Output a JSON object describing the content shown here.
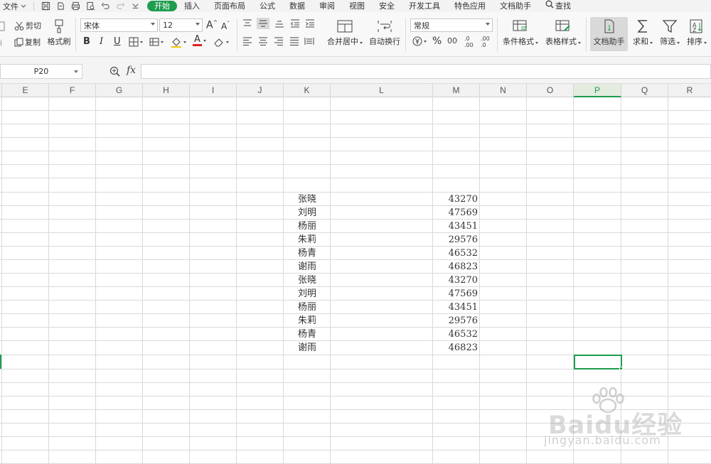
{
  "menu": {
    "file_label": "文件",
    "tabs": [
      "开始",
      "插入",
      "页面布局",
      "公式",
      "数据",
      "审阅",
      "视图",
      "安全",
      "开发工具",
      "特色应用",
      "文档助手"
    ],
    "active_tab": "开始",
    "search_label": "查找"
  },
  "ribbon": {
    "cut_label": "剪切",
    "copy_label": "复制",
    "format_painter_label": "格式刷",
    "font_name": "宋体",
    "font_size": "12",
    "merge_center_label": "合并居中",
    "wrap_text_label": "自动换行",
    "number_format": "常规",
    "conditional_format_label": "条件格式",
    "table_style_label": "表格样式",
    "doc_assistant_label": "文档助手",
    "sum_label": "求和",
    "filter_label": "筛选",
    "sort_label": "排序",
    "bold": "B",
    "italic": "I",
    "underline": "U",
    "font_color_letter": "A",
    "percent": "%"
  },
  "formula_bar": {
    "name_box": "P20",
    "fx_label": "fx",
    "content": ""
  },
  "columns": [
    "E",
    "F",
    "G",
    "H",
    "I",
    "J",
    "K",
    "L",
    "M",
    "N",
    "O",
    "P",
    "Q",
    "R"
  ],
  "selected_column": "P",
  "data_rows": [
    {
      "name": "张晓",
      "value": "43270"
    },
    {
      "name": "刘明",
      "value": "47569"
    },
    {
      "name": "杨丽",
      "value": "43451"
    },
    {
      "name": "朱莉",
      "value": "29576"
    },
    {
      "name": "杨青",
      "value": "46532"
    },
    {
      "name": "谢雨",
      "value": "46823"
    },
    {
      "name": "张晓",
      "value": "43270"
    },
    {
      "name": "刘明",
      "value": "47569"
    },
    {
      "name": "杨丽",
      "value": "43451"
    },
    {
      "name": "朱莉",
      "value": "29576"
    },
    {
      "name": "杨青",
      "value": "46532"
    },
    {
      "name": "谢雨",
      "value": "46823"
    }
  ],
  "watermark": {
    "logo": "Baidu经验",
    "url": "jingyan.baidu.com"
  },
  "colors": {
    "accent": "#1e9d4f",
    "grid_line": "#d9d9d9"
  }
}
